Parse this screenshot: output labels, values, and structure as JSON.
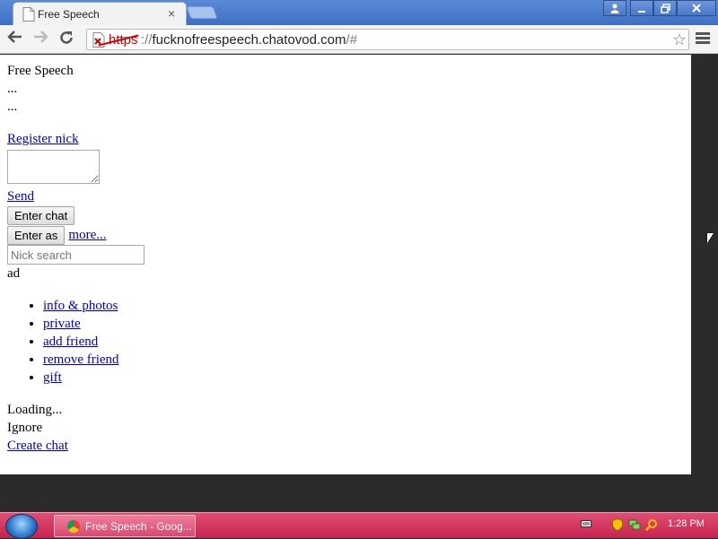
{
  "browser": {
    "tab_title": "Free Speech",
    "tab_close": "×",
    "url_scheme": "https",
    "url_separator": "://",
    "url_host": "fucknofreespeech.chatovod.com",
    "url_path": "/#",
    "star": "☆"
  },
  "page": {
    "title": "Free Speech",
    "dots1": "...",
    "dots2": "...",
    "register_link": "Register nick",
    "send_link": "Send",
    "enter_chat_button": "Enter chat",
    "enter_as_button": "Enter as",
    "more_link": "more...",
    "nick_search_placeholder": "Nick search",
    "ad_text": "ad",
    "menu_items": [
      "info & photos",
      "private",
      "add friend",
      "remove friend",
      "gift"
    ],
    "loading_text": "Loading...",
    "ignore_text": "Ignore",
    "create_chat_link": "Create chat"
  },
  "taskbar": {
    "task_label": "Free Speech - Goog...",
    "clock": "1:28 PM"
  },
  "colors": {
    "taskbar": "#d9355f",
    "link": "#0000cc",
    "titlebar": "#4a78c9"
  }
}
